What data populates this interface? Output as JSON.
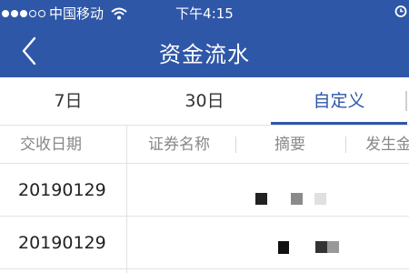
{
  "status_bar": {
    "carrier": "中国移动",
    "time": "下午4:15"
  },
  "nav": {
    "title": "资金流水",
    "back_icon": "chevron-left-icon"
  },
  "tabs": [
    {
      "label": "7日",
      "active": false
    },
    {
      "label": "30日",
      "active": false
    },
    {
      "label": "自定义",
      "active": true
    }
  ],
  "table": {
    "columns": [
      "交收日期",
      "证券名称",
      "摘要",
      "发生金"
    ],
    "rows": [
      {
        "date": "20190129"
      },
      {
        "date": "20190129"
      }
    ]
  },
  "colors": {
    "brand": "#2f57a8",
    "active_tab": "#2f57a8"
  }
}
